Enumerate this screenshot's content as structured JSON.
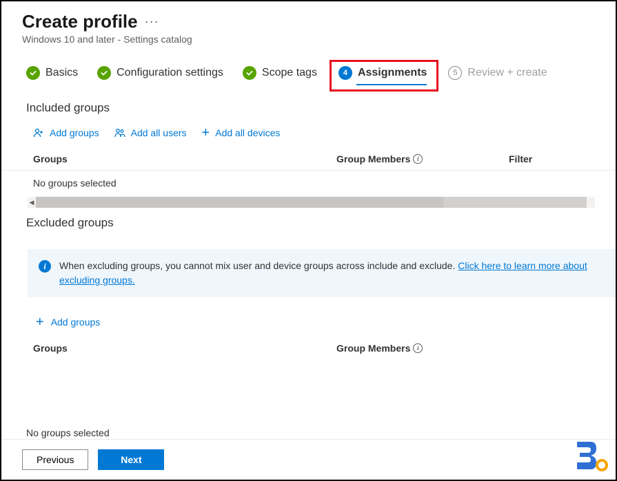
{
  "header": {
    "title": "Create profile",
    "more": "···",
    "subtitle": "Windows 10 and later - Settings catalog"
  },
  "steps": {
    "basics": "Basics",
    "config": "Configuration settings",
    "scope": "Scope tags",
    "assignments_num": "4",
    "assignments": "Assignments",
    "review_num": "5",
    "review": "Review + create"
  },
  "included": {
    "title": "Included groups",
    "add_groups": "Add groups",
    "add_all_users": "Add all users",
    "add_all_devices": "Add all devices",
    "col_groups": "Groups",
    "col_members": "Group Members",
    "col_filter": "Filter",
    "empty": "No groups selected"
  },
  "excluded": {
    "title": "Excluded groups",
    "notice_text": "When excluding groups, you cannot mix user and device groups across include and exclude. ",
    "notice_link": "Click here to learn more about excluding groups.",
    "add_groups": "Add groups",
    "col_groups": "Groups",
    "col_members": "Group Members",
    "empty": "No groups selected"
  },
  "footer": {
    "previous": "Previous",
    "next": "Next"
  }
}
